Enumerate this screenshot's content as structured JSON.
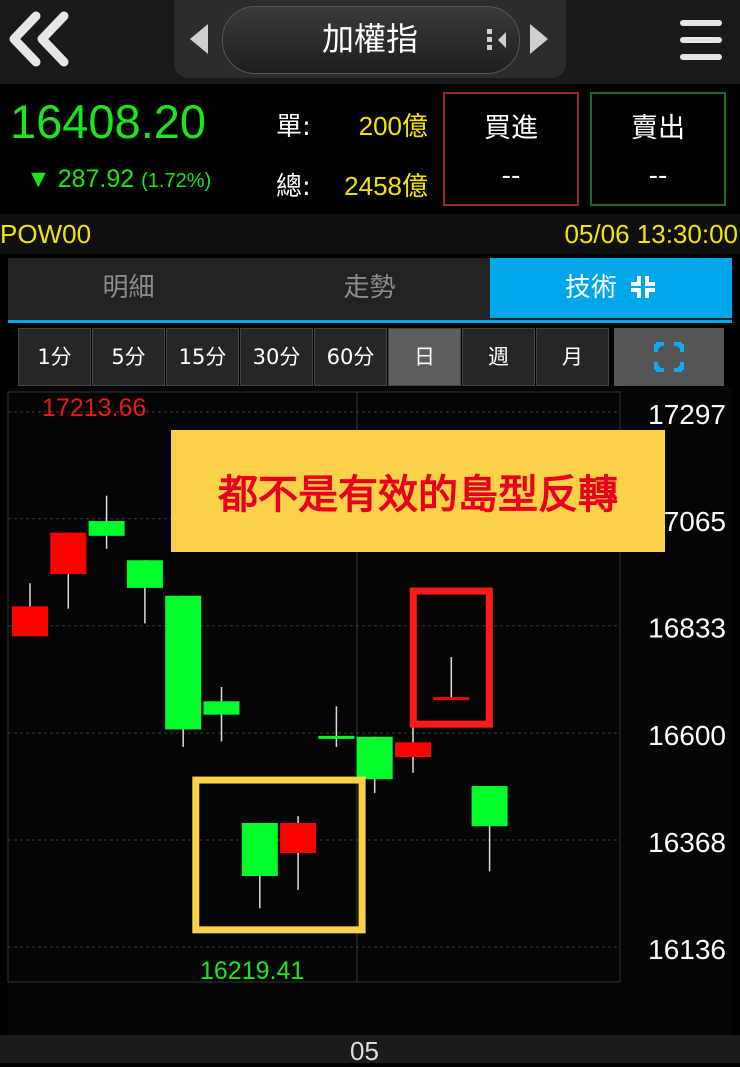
{
  "header": {
    "title": "加權指",
    "icons": [
      "back-double-chevron-icon",
      "prev-arrow-icon",
      "sort-icon",
      "next-arrow-icon",
      "menu-icon"
    ]
  },
  "quote": {
    "price": "16408.20",
    "change_arrow": "▼",
    "change": "287.92",
    "change_pct": "(1.72%)",
    "unit_label": "單:",
    "unit_value": "200億",
    "total_label": "總:",
    "total_value": "2458億",
    "buy_label": "買進",
    "buy_value": "--",
    "sell_label": "賣出",
    "sell_value": "--"
  },
  "code": "POW00",
  "datetime": "05/06 13:30:00",
  "tabs": [
    {
      "label": "明細",
      "active": false
    },
    {
      "label": "走勢",
      "active": false
    },
    {
      "label": "技術",
      "active": true
    }
  ],
  "periods": [
    {
      "label": "1分",
      "active": false
    },
    {
      "label": "5分",
      "active": false
    },
    {
      "label": "15分",
      "active": false
    },
    {
      "label": "30分",
      "active": false
    },
    {
      "label": "60分",
      "active": false
    },
    {
      "label": "日",
      "active": true
    },
    {
      "label": "週",
      "active": false
    },
    {
      "label": "月",
      "active": false
    }
  ],
  "colors": {
    "up": "#ff0000",
    "down": "#00ff2a",
    "accent": "#00a6ea",
    "yellow": "#f2e600",
    "annotation_bg": "#f9d24a",
    "annotation_text": "#e8001c",
    "highlight_yellow": "#f9d24a",
    "highlight_red": "#ff1a1a"
  },
  "chart_data": {
    "type": "candlestick",
    "y_ticks": [
      17297,
      17065,
      16833,
      16600,
      16368,
      16136
    ],
    "ylim": [
      16060,
      17340
    ],
    "max_label": "17213.66",
    "min_label": "16219.41",
    "x_tick_label": "05",
    "candles": [
      {
        "open": 16810,
        "high": 16925,
        "low": 16810,
        "close": 16875,
        "color": "up"
      },
      {
        "open": 16945,
        "high": 17035,
        "low": 16870,
        "close": 17035,
        "color": "up"
      },
      {
        "open": 17060,
        "high": 17115,
        "low": 17000,
        "close": 17028,
        "color": "down"
      },
      {
        "open": 16975,
        "high": 16975,
        "low": 16838,
        "close": 16915,
        "color": "down"
      },
      {
        "open": 16898,
        "high": 16898,
        "low": 16570,
        "close": 16608,
        "color": "down"
      },
      {
        "open": 16669,
        "high": 16700,
        "low": 16582,
        "close": 16640,
        "color": "down"
      },
      {
        "open": 16405,
        "high": 16405,
        "low": 16220,
        "close": 16290,
        "color": "down"
      },
      {
        "open": 16340,
        "high": 16420,
        "low": 16260,
        "close": 16405,
        "color": "up"
      },
      {
        "open": 16594,
        "high": 16658,
        "low": 16570,
        "close": 16594,
        "color": "down"
      },
      {
        "open": 16592,
        "high": 16592,
        "low": 16470,
        "close": 16500,
        "color": "down"
      },
      {
        "open": 16548,
        "high": 16615,
        "low": 16514,
        "close": 16580,
        "color": "up"
      },
      {
        "open": 16678,
        "high": 16765,
        "low": 16678,
        "close": 16678,
        "color": "up"
      },
      {
        "open": 16485,
        "high": 16485,
        "low": 16300,
        "close": 16398,
        "color": "down"
      }
    ],
    "annotation": "都不是有效的島型反轉",
    "highlights": [
      {
        "color": "yellow",
        "from_candle": 6,
        "to_candle": 7
      },
      {
        "color": "red",
        "from_candle": 11,
        "to_candle": 11
      }
    ]
  }
}
